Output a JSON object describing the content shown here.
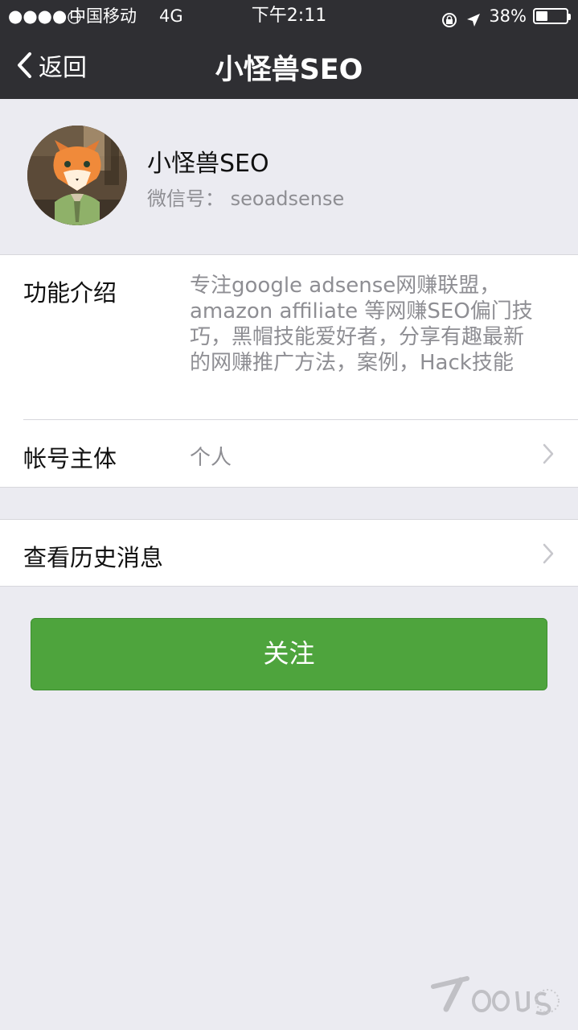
{
  "status_bar": {
    "signal": "●●●●○",
    "carrier": "中国移动",
    "network": "4G",
    "time": "下午2:11",
    "battery_percent": "38%",
    "battery_level": 0.38
  },
  "nav": {
    "back_label": "返回",
    "title": "小怪兽SEO"
  },
  "profile": {
    "name": "小怪兽SEO",
    "wechat_id": "微信号： seoadsense"
  },
  "details": {
    "intro_label": "功能介绍",
    "intro_text": "专注google adsense网赚联盟，\namazon affiliate 等网赚SEO偏门技\n巧，黑帽技能爱好者，分享有趣最新\n的网赚推广方法，案例，Hack技能",
    "account_label": "帐号主体",
    "account_value": "个人"
  },
  "history": {
    "label": "查看历史消息"
  },
  "actions": {
    "follow_label": "关注"
  },
  "colors": {
    "top_bar": "#2f2f33",
    "page_bg": "#ebebf1",
    "follow_button": "#4ea43d"
  }
}
